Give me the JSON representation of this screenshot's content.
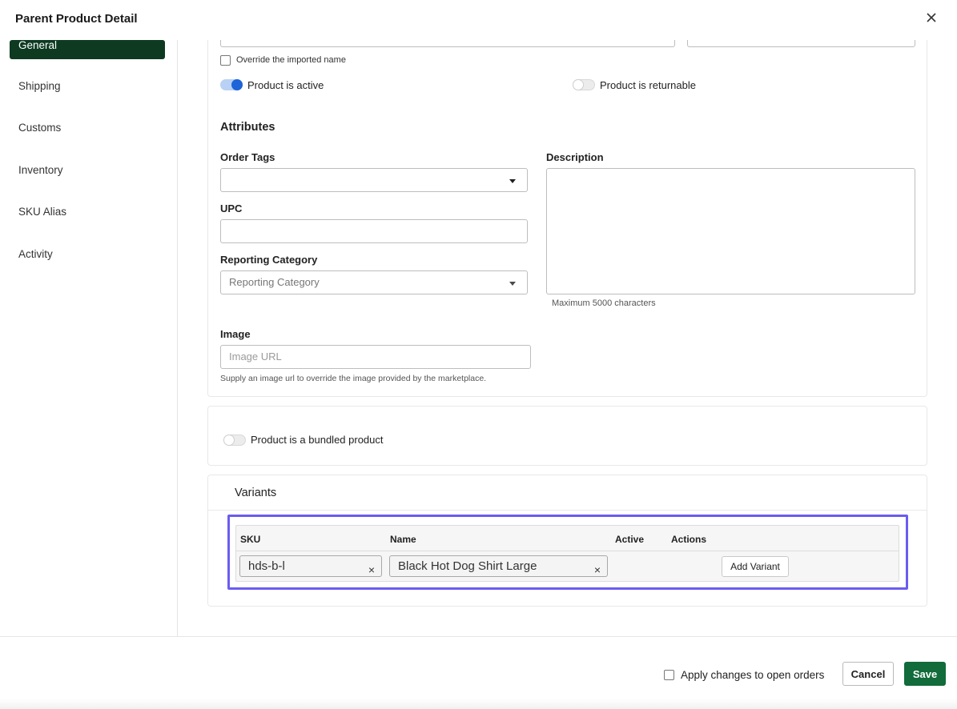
{
  "header": {
    "title": "Parent Product Detail",
    "close_icon": "close-icon"
  },
  "sidebar": {
    "items": [
      {
        "label": "General",
        "active": true
      },
      {
        "label": "Shipping"
      },
      {
        "label": "Customs"
      },
      {
        "label": "Inventory"
      },
      {
        "label": "SKU Alias"
      },
      {
        "label": "Activity"
      }
    ]
  },
  "general": {
    "override_label": "Override the imported name",
    "active_label": "Product is active",
    "returnable_label": "Product is returnable"
  },
  "attributes": {
    "heading": "Attributes",
    "order_tags_label": "Order Tags",
    "upc_label": "UPC",
    "reporting_label": "Reporting Category",
    "reporting_placeholder": "Reporting Category",
    "description_label": "Description",
    "description_hint": "Maximum 5000 characters",
    "image_label": "Image",
    "image_placeholder": "Image URL",
    "image_hint": "Supply an image url to override the image provided by the marketplace."
  },
  "bundle": {
    "label": "Product is a bundled product"
  },
  "variants": {
    "heading": "Variants",
    "columns": {
      "sku": "SKU",
      "name": "Name",
      "active": "Active",
      "actions": "Actions"
    },
    "row": {
      "sku": "hds-b-l",
      "name": "Black Hot Dog Shirt Large"
    },
    "add_label": "Add Variant",
    "clear_glyph": "×"
  },
  "footer": {
    "apply_label": "Apply changes to open orders",
    "cancel_label": "Cancel",
    "save_label": "Save"
  },
  "colors": {
    "accent_active_nav": "#0d3a21",
    "save_green": "#116b3a",
    "toggle_blue": "#1e63d8",
    "highlight_purple": "#6a5cf0"
  }
}
